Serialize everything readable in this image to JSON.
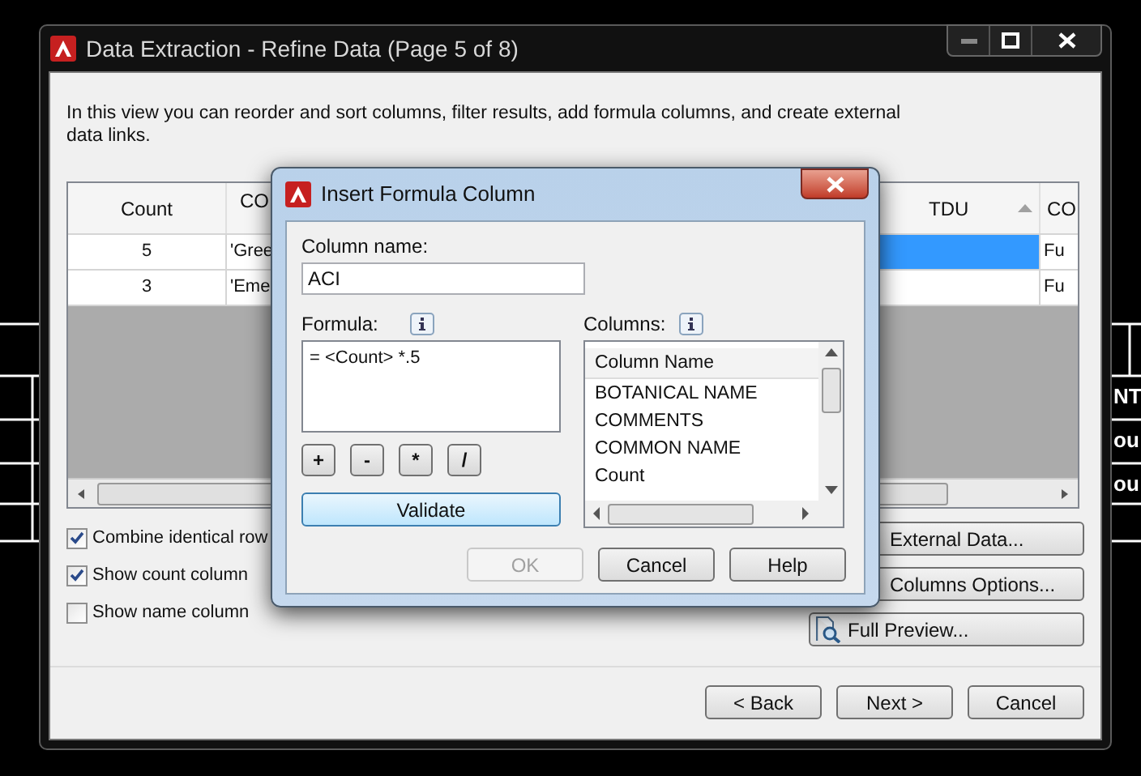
{
  "background": {
    "edge_texts": [
      "NT",
      "ou",
      "ou"
    ]
  },
  "window": {
    "title": "Data Extraction - Refine Data (Page 5 of 8)",
    "description": "In this view you can reorder and sort columns, filter results, add formula columns, and create external data links.",
    "table": {
      "columns": [
        {
          "label": "Count",
          "sorted": false
        },
        {
          "label": "CO",
          "sorted": false
        },
        {
          "label": "TDU",
          "sorted": true
        },
        {
          "label": "CO",
          "sorted": false
        }
      ],
      "rows": [
        {
          "cells": [
            {
              "text": "5",
              "selected": false
            },
            {
              "text": "'Gree",
              "selected": false
            },
            {
              "selected": true
            },
            {
              "text": "Fu",
              "selected": false
            }
          ]
        },
        {
          "cells": [
            {
              "text": "3",
              "selected": false
            },
            {
              "text": "'Eme",
              "selected": false
            },
            {
              "selected": false
            },
            {
              "text": "Fu",
              "selected": false
            }
          ]
        }
      ]
    },
    "options": [
      {
        "label": "Combine identical row",
        "checked": true
      },
      {
        "label": "Show count column",
        "checked": true
      },
      {
        "label": "Show name column",
        "checked": false
      }
    ],
    "side_buttons": [
      {
        "label": "External Data...",
        "kind": "plain"
      },
      {
        "label": "Columns Options...",
        "kind": "plain"
      },
      {
        "label": "Full Preview...",
        "kind": "preview"
      }
    ],
    "nav_buttons": [
      "< Back",
      "Next >",
      "Cancel"
    ]
  },
  "dialog": {
    "title": "Insert Formula Column",
    "column_name_label": "Column name:",
    "column_name": "ACI",
    "formula_label": "Formula:",
    "formula": "= <Count> *.5",
    "operators": [
      "+",
      "-",
      "*",
      "/"
    ],
    "validate": "Validate",
    "columns_label": "Columns:",
    "list_header": "Column Name",
    "list_items": [
      "BOTANICAL NAME",
      "COMMENTS",
      "COMMON NAME",
      "Count"
    ],
    "buttons": [
      {
        "label": "OK",
        "disabled": true
      },
      {
        "label": "Cancel",
        "disabled": false
      },
      {
        "label": "Help",
        "disabled": false
      }
    ]
  }
}
